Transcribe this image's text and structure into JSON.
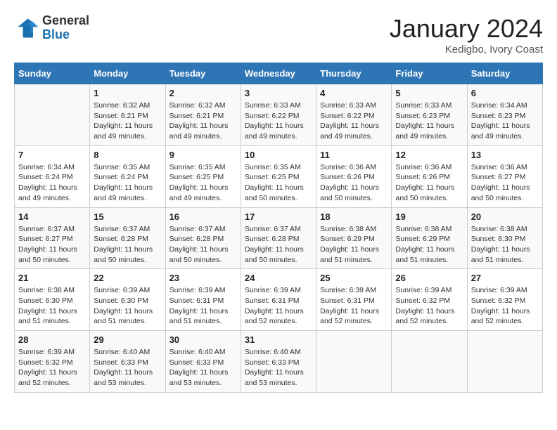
{
  "header": {
    "logo_general": "General",
    "logo_blue": "Blue",
    "month_title": "January 2024",
    "location": "Kedigbo, Ivory Coast"
  },
  "days_of_week": [
    "Sunday",
    "Monday",
    "Tuesday",
    "Wednesday",
    "Thursday",
    "Friday",
    "Saturday"
  ],
  "weeks": [
    [
      {
        "day": "",
        "sunrise": "",
        "sunset": "",
        "daylight": ""
      },
      {
        "day": "1",
        "sunrise": "Sunrise: 6:32 AM",
        "sunset": "Sunset: 6:21 PM",
        "daylight": "Daylight: 11 hours and 49 minutes."
      },
      {
        "day": "2",
        "sunrise": "Sunrise: 6:32 AM",
        "sunset": "Sunset: 6:21 PM",
        "daylight": "Daylight: 11 hours and 49 minutes."
      },
      {
        "day": "3",
        "sunrise": "Sunrise: 6:33 AM",
        "sunset": "Sunset: 6:22 PM",
        "daylight": "Daylight: 11 hours and 49 minutes."
      },
      {
        "day": "4",
        "sunrise": "Sunrise: 6:33 AM",
        "sunset": "Sunset: 6:22 PM",
        "daylight": "Daylight: 11 hours and 49 minutes."
      },
      {
        "day": "5",
        "sunrise": "Sunrise: 6:33 AM",
        "sunset": "Sunset: 6:23 PM",
        "daylight": "Daylight: 11 hours and 49 minutes."
      },
      {
        "day": "6",
        "sunrise": "Sunrise: 6:34 AM",
        "sunset": "Sunset: 6:23 PM",
        "daylight": "Daylight: 11 hours and 49 minutes."
      }
    ],
    [
      {
        "day": "7",
        "sunrise": "Sunrise: 6:34 AM",
        "sunset": "Sunset: 6:24 PM",
        "daylight": "Daylight: 11 hours and 49 minutes."
      },
      {
        "day": "8",
        "sunrise": "Sunrise: 6:35 AM",
        "sunset": "Sunset: 6:24 PM",
        "daylight": "Daylight: 11 hours and 49 minutes."
      },
      {
        "day": "9",
        "sunrise": "Sunrise: 6:35 AM",
        "sunset": "Sunset: 6:25 PM",
        "daylight": "Daylight: 11 hours and 49 minutes."
      },
      {
        "day": "10",
        "sunrise": "Sunrise: 6:35 AM",
        "sunset": "Sunset: 6:25 PM",
        "daylight": "Daylight: 11 hours and 50 minutes."
      },
      {
        "day": "11",
        "sunrise": "Sunrise: 6:36 AM",
        "sunset": "Sunset: 6:26 PM",
        "daylight": "Daylight: 11 hours and 50 minutes."
      },
      {
        "day": "12",
        "sunrise": "Sunrise: 6:36 AM",
        "sunset": "Sunset: 6:26 PM",
        "daylight": "Daylight: 11 hours and 50 minutes."
      },
      {
        "day": "13",
        "sunrise": "Sunrise: 6:36 AM",
        "sunset": "Sunset: 6:27 PM",
        "daylight": "Daylight: 11 hours and 50 minutes."
      }
    ],
    [
      {
        "day": "14",
        "sunrise": "Sunrise: 6:37 AM",
        "sunset": "Sunset: 6:27 PM",
        "daylight": "Daylight: 11 hours and 50 minutes."
      },
      {
        "day": "15",
        "sunrise": "Sunrise: 6:37 AM",
        "sunset": "Sunset: 6:28 PM",
        "daylight": "Daylight: 11 hours and 50 minutes."
      },
      {
        "day": "16",
        "sunrise": "Sunrise: 6:37 AM",
        "sunset": "Sunset: 6:28 PM",
        "daylight": "Daylight: 11 hours and 50 minutes."
      },
      {
        "day": "17",
        "sunrise": "Sunrise: 6:37 AM",
        "sunset": "Sunset: 6:28 PM",
        "daylight": "Daylight: 11 hours and 50 minutes."
      },
      {
        "day": "18",
        "sunrise": "Sunrise: 6:38 AM",
        "sunset": "Sunset: 6:29 PM",
        "daylight": "Daylight: 11 hours and 51 minutes."
      },
      {
        "day": "19",
        "sunrise": "Sunrise: 6:38 AM",
        "sunset": "Sunset: 6:29 PM",
        "daylight": "Daylight: 11 hours and 51 minutes."
      },
      {
        "day": "20",
        "sunrise": "Sunrise: 6:38 AM",
        "sunset": "Sunset: 6:30 PM",
        "daylight": "Daylight: 11 hours and 51 minutes."
      }
    ],
    [
      {
        "day": "21",
        "sunrise": "Sunrise: 6:38 AM",
        "sunset": "Sunset: 6:30 PM",
        "daylight": "Daylight: 11 hours and 51 minutes."
      },
      {
        "day": "22",
        "sunrise": "Sunrise: 6:39 AM",
        "sunset": "Sunset: 6:30 PM",
        "daylight": "Daylight: 11 hours and 51 minutes."
      },
      {
        "day": "23",
        "sunrise": "Sunrise: 6:39 AM",
        "sunset": "Sunset: 6:31 PM",
        "daylight": "Daylight: 11 hours and 51 minutes."
      },
      {
        "day": "24",
        "sunrise": "Sunrise: 6:39 AM",
        "sunset": "Sunset: 6:31 PM",
        "daylight": "Daylight: 11 hours and 52 minutes."
      },
      {
        "day": "25",
        "sunrise": "Sunrise: 6:39 AM",
        "sunset": "Sunset: 6:31 PM",
        "daylight": "Daylight: 11 hours and 52 minutes."
      },
      {
        "day": "26",
        "sunrise": "Sunrise: 6:39 AM",
        "sunset": "Sunset: 6:32 PM",
        "daylight": "Daylight: 11 hours and 52 minutes."
      },
      {
        "day": "27",
        "sunrise": "Sunrise: 6:39 AM",
        "sunset": "Sunset: 6:32 PM",
        "daylight": "Daylight: 11 hours and 52 minutes."
      }
    ],
    [
      {
        "day": "28",
        "sunrise": "Sunrise: 6:39 AM",
        "sunset": "Sunset: 6:32 PM",
        "daylight": "Daylight: 11 hours and 52 minutes."
      },
      {
        "day": "29",
        "sunrise": "Sunrise: 6:40 AM",
        "sunset": "Sunset: 6:33 PM",
        "daylight": "Daylight: 11 hours and 53 minutes."
      },
      {
        "day": "30",
        "sunrise": "Sunrise: 6:40 AM",
        "sunset": "Sunset: 6:33 PM",
        "daylight": "Daylight: 11 hours and 53 minutes."
      },
      {
        "day": "31",
        "sunrise": "Sunrise: 6:40 AM",
        "sunset": "Sunset: 6:33 PM",
        "daylight": "Daylight: 11 hours and 53 minutes."
      },
      {
        "day": "",
        "sunrise": "",
        "sunset": "",
        "daylight": ""
      },
      {
        "day": "",
        "sunrise": "",
        "sunset": "",
        "daylight": ""
      },
      {
        "day": "",
        "sunrise": "",
        "sunset": "",
        "daylight": ""
      }
    ]
  ]
}
